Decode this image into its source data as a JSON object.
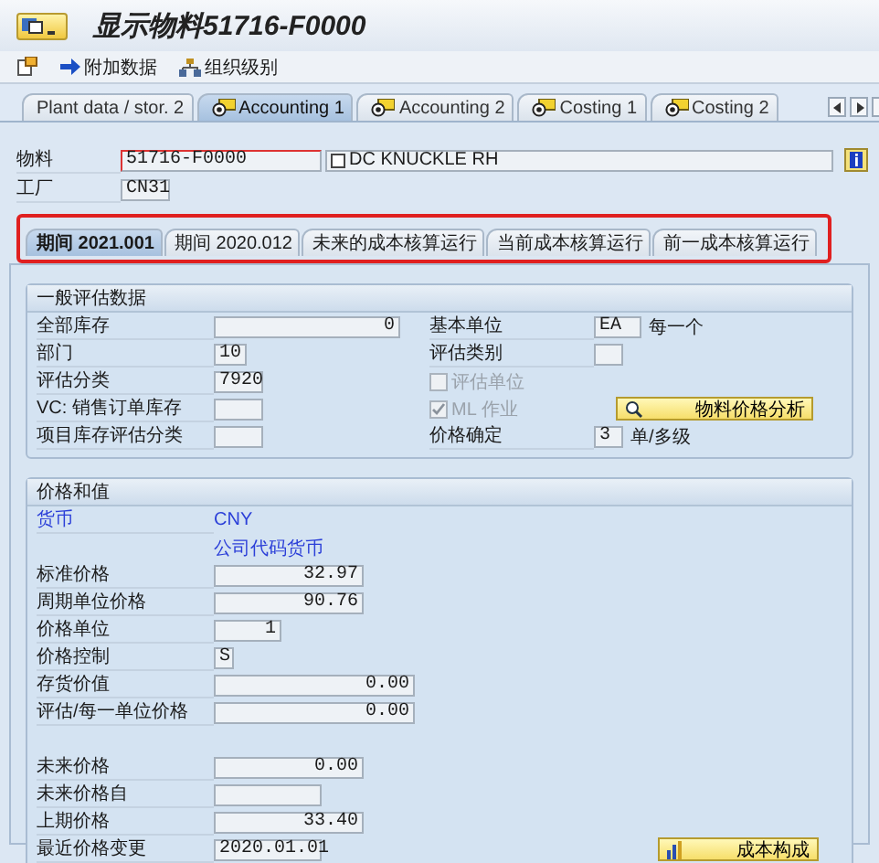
{
  "window": {
    "title": "显示物料51716-F0000"
  },
  "toolbar": [
    {
      "label": "附加数据"
    },
    {
      "label": "组织级别"
    }
  ],
  "tabs": [
    {
      "label": "Plant data / stor. 2",
      "selected": false
    },
    {
      "label": "Accounting 1",
      "selected": true
    },
    {
      "label": "Accounting 2",
      "selected": false
    },
    {
      "label": "Costing 1",
      "selected": false
    },
    {
      "label": "Costing 2",
      "selected": false
    }
  ],
  "header": {
    "material_label": "物料",
    "material": "51716-F0000",
    "description": "DC KNUCKLE RH",
    "plant_label": "工厂",
    "plant": "CN31"
  },
  "subtabs": [
    {
      "label": "期间 2021.001",
      "selected": true
    },
    {
      "label": "期间 2020.012",
      "selected": false
    },
    {
      "label": "未来的成本核算运行",
      "selected": false
    },
    {
      "label": "当前成本核算运行",
      "selected": false
    },
    {
      "label": "前一成本核算运行",
      "selected": false
    }
  ],
  "general": {
    "title": "一般评估数据",
    "left": [
      {
        "label": "全部库存",
        "value": "0"
      },
      {
        "label": "部门",
        "value": "10"
      },
      {
        "label": "评估分类",
        "value": "7920"
      },
      {
        "label": "VC: 销售订单库存"
      },
      {
        "label": "项目库存评估分类"
      }
    ],
    "right": [
      {
        "kind": "field",
        "label": "基本单位",
        "value": "EA",
        "note": "每一个"
      },
      {
        "kind": "field",
        "label": "评估类别"
      },
      {
        "kind": "checkbox",
        "label": "评估单位",
        "checked": false,
        "disabled": true
      },
      {
        "kind": "checkbox",
        "label": "ML 作业",
        "checked": true,
        "disabled": true
      },
      {
        "kind": "field",
        "label": "价格确定",
        "value": "3",
        "note": "单/多级"
      }
    ],
    "button": "物料价格分析"
  },
  "prices": {
    "title": "价格和值",
    "currency": {
      "label": "货币",
      "value": "CNY",
      "caption": "公司代码货币"
    },
    "rows": [
      {
        "label": "标准价格",
        "value": "32.97"
      },
      {
        "label": "周期单位价格",
        "value": "90.76"
      },
      {
        "label": "价格单位",
        "value": "1"
      },
      {
        "label": "价格控制",
        "value": "S"
      },
      {
        "label": "存货价值",
        "value": "0.00"
      },
      {
        "label": "评估/每一单位价格",
        "value": "0.00"
      }
    ],
    "future_rows": [
      {
        "label": "未来价格",
        "value": "0.00"
      },
      {
        "label": "未来价格自"
      },
      {
        "label": "上期价格",
        "value": "33.40"
      },
      {
        "label": "最近价格变更",
        "value": "2020.01.01"
      }
    ],
    "button": "成本构成"
  }
}
